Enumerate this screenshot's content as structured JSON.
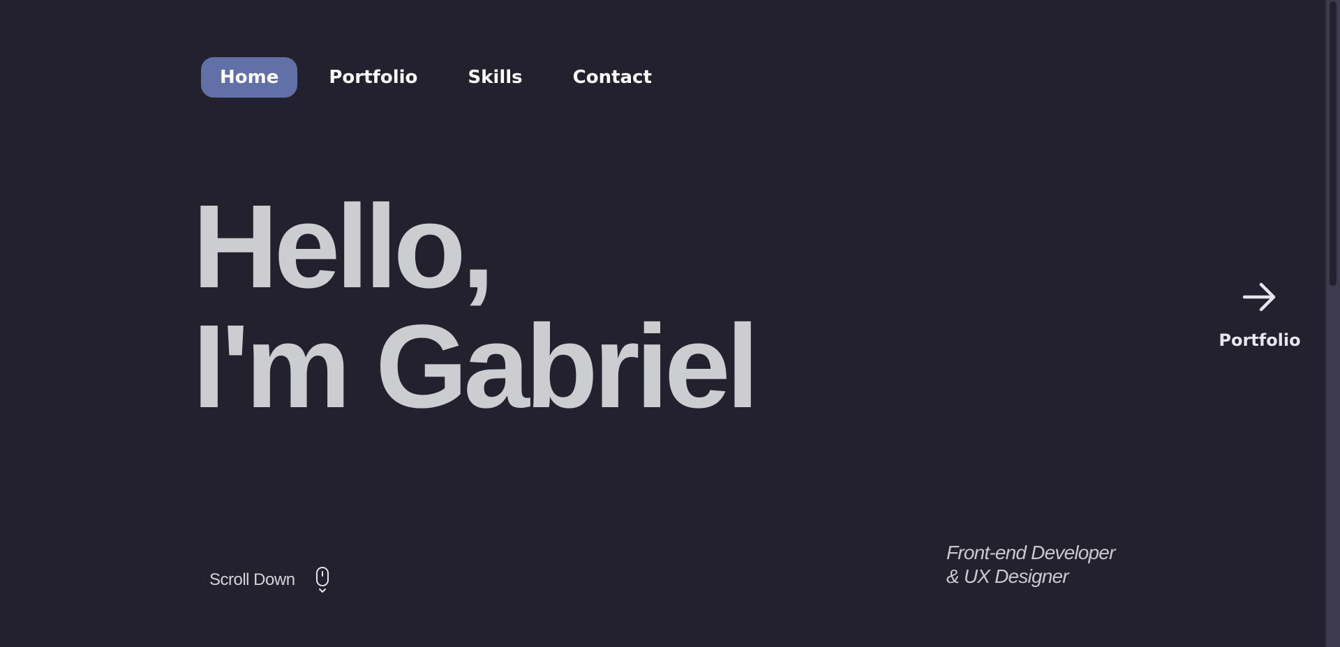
{
  "nav": {
    "items": [
      {
        "label": "Home",
        "active": true
      },
      {
        "label": "Portfolio",
        "active": false
      },
      {
        "label": "Skills",
        "active": false
      },
      {
        "label": "Contact",
        "active": false
      }
    ]
  },
  "hero": {
    "line1": "Hello,",
    "line2": "I'm Gabriel"
  },
  "next_link": {
    "icon": "arrow-right-icon",
    "label": "Portfolio"
  },
  "scroll_down": {
    "label": "Scroll Down",
    "icon": "mouse-scroll-icon"
  },
  "role": {
    "line1": "Front-end Developer",
    "line2": "& UX Designer"
  },
  "colors": {
    "background": "#23212d",
    "accent": "#6270a8",
    "heading": "#cccdd0",
    "scrollbar": "#3f3b4f"
  }
}
